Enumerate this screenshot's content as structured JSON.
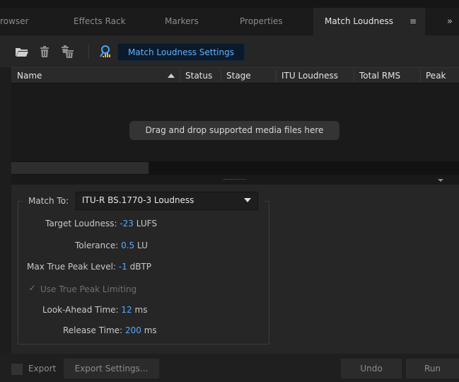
{
  "tabs": [
    {
      "label": "rowser",
      "active": false
    },
    {
      "label": "Effects Rack",
      "active": false
    },
    {
      "label": "Markers",
      "active": false
    },
    {
      "label": "Properties",
      "active": false
    },
    {
      "label": "Match Loudness",
      "active": true
    }
  ],
  "tab_menu_glyph": "≡",
  "tab_overflow_glyph": "»",
  "toolbar": {
    "icons": [
      "folder-open-icon",
      "trash-icon",
      "trash-all-icon",
      "scan-icon"
    ],
    "settings_label": "Match Loudness Settings"
  },
  "table": {
    "columns": [
      "Name",
      "Status",
      "Stage",
      "ITU Loudness",
      "Total RMS",
      "Peak"
    ],
    "sorted_column": "Name",
    "sort_direction": "ascending",
    "rows": [],
    "drop_hint": "Drag and drop supported media files here"
  },
  "settings": {
    "match_to_label": "Match To:",
    "match_to_value": "ITU-R BS.1770-3 Loudness",
    "target_loudness": {
      "label": "Target Loudness:",
      "value": "-23",
      "unit": "LUFS"
    },
    "tolerance": {
      "label": "Tolerance:",
      "value": "0.5",
      "unit": "LU"
    },
    "max_true_peak": {
      "label": "Max True Peak Level:",
      "value": "-1",
      "unit": "dBTP"
    },
    "use_true_peak_limiting": {
      "label": "Use True Peak Limiting",
      "checked": true,
      "enabled": false
    },
    "look_ahead": {
      "label": "Look-Ahead Time:",
      "value": "12",
      "unit": "ms"
    },
    "release": {
      "label": "Release Time:",
      "value": "200",
      "unit": "ms"
    }
  },
  "bottom": {
    "export_label": "Export",
    "export_checked": false,
    "export_settings_label": "Export Settings...",
    "undo_label": "Undo",
    "run_label": "Run"
  },
  "colors": {
    "accent_blue": "#55aaff",
    "settings_button_text": "#5fb3ff",
    "panel_bg": "#262626"
  }
}
